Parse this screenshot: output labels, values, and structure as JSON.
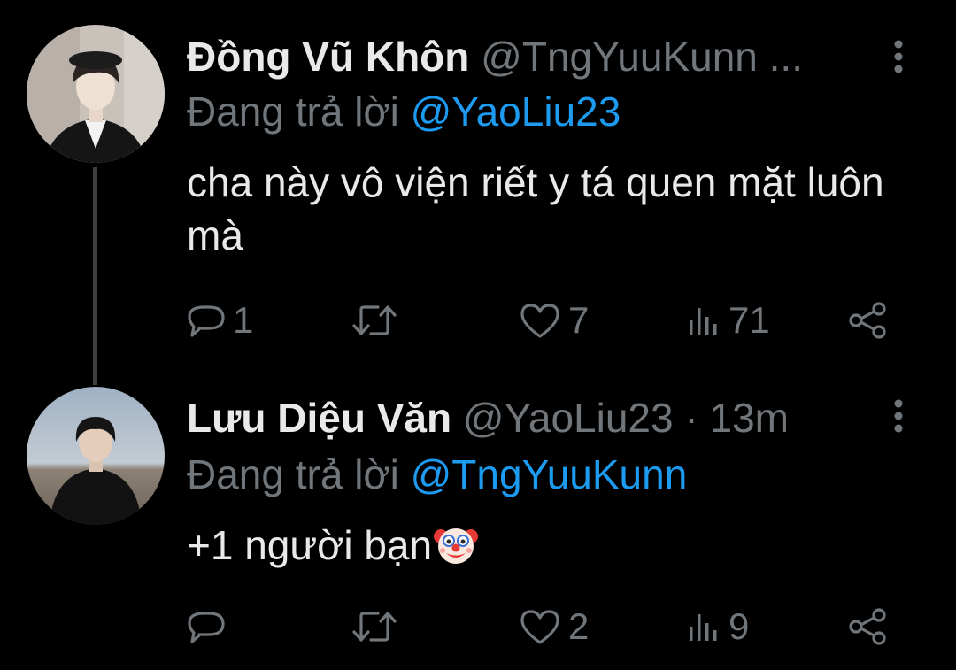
{
  "tweets": [
    {
      "display_name": "Đồng Vũ Khôn",
      "handle": "@TngYuuKunn ...",
      "replying_label": "Đang trả lời",
      "replying_to": "@YaoLiu23",
      "text": "cha này vô viện riết y tá quen mặt luôn mà",
      "reply_count": "1",
      "retweet_count": "",
      "like_count": "7",
      "view_count": "71"
    },
    {
      "display_name": "Lưu Diệu Văn",
      "handle": "@YaoLiu23",
      "separator": "·",
      "time": "13m",
      "replying_label": "Đang trả lời",
      "replying_to": "@TngYuuKunn",
      "text": "+1 người bạn",
      "emoji": "clown-face-emoji",
      "reply_count": "",
      "retweet_count": "",
      "like_count": "2",
      "view_count": "9"
    }
  ],
  "icons": {
    "reply": "reply-icon",
    "retweet": "retweet-icon",
    "like": "heart-icon",
    "views": "views-icon",
    "share": "share-icon",
    "more": "more-vertical-icon"
  },
  "colors": {
    "background": "#000000",
    "text_primary": "#e7e9ea",
    "text_secondary": "#71767b",
    "mention": "#1d9bf0",
    "thread_line": "#3e4144"
  }
}
